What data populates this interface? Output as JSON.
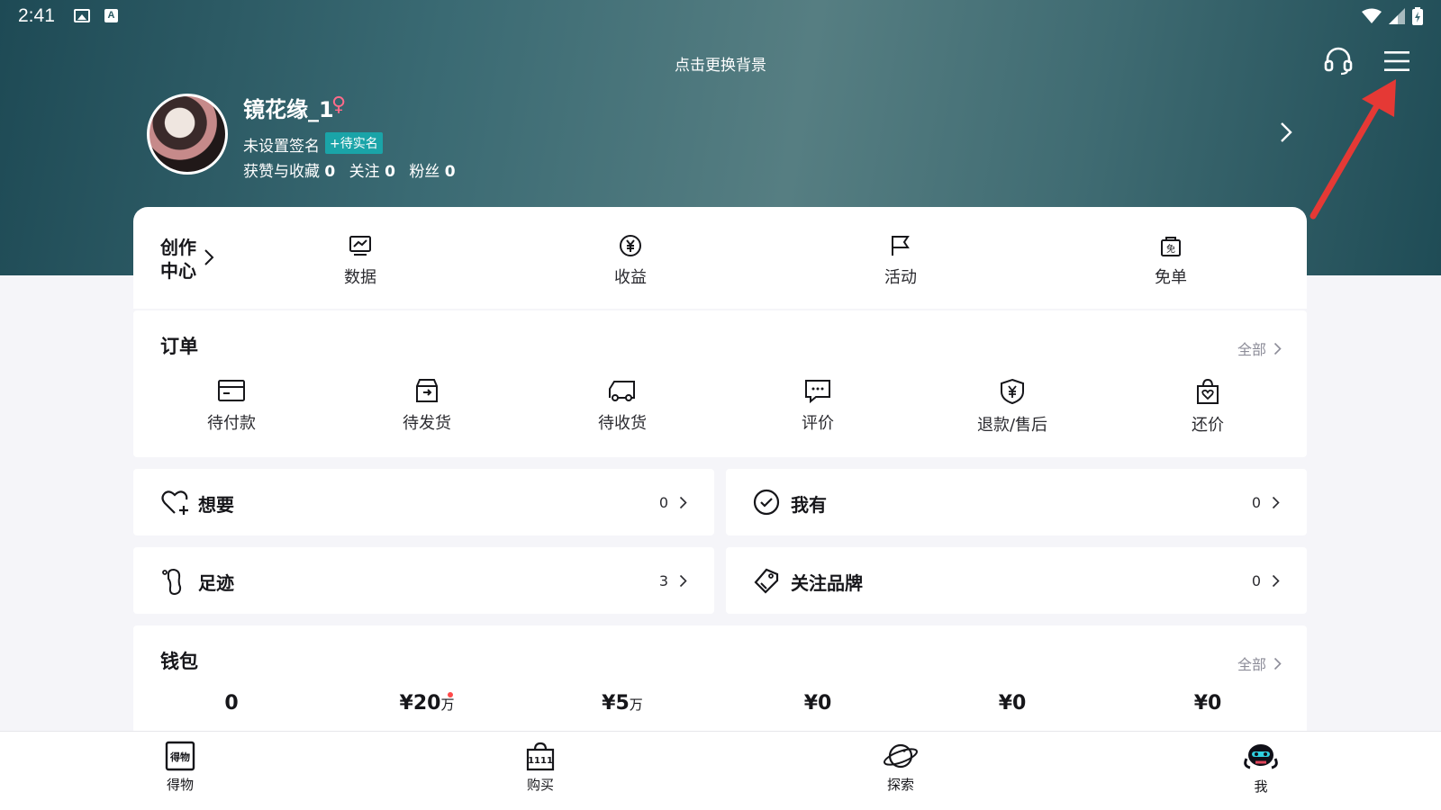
{
  "status_bar": {
    "time": "2:41"
  },
  "header": {
    "change_background": "点击更换背景"
  },
  "profile": {
    "username": "镜花缘_1",
    "gender_symbol": "♀",
    "signature": "未设置签名",
    "verify_badge": "+待实名",
    "likes_label": "获赞与收藏",
    "likes_value": "0",
    "following_label": "关注",
    "following_value": "0",
    "fans_label": "粉丝",
    "fans_value": "0"
  },
  "creation": {
    "label": "创作中心",
    "items": [
      {
        "label": "数据",
        "icon": "chart-icon"
      },
      {
        "label": "收益",
        "icon": "yen-coin-icon"
      },
      {
        "label": "活动",
        "icon": "flag-icon"
      },
      {
        "label": "免单",
        "icon": "free-bag-icon"
      }
    ]
  },
  "orders": {
    "title": "订单",
    "all_label": "全部",
    "items": [
      {
        "label": "待付款",
        "icon": "wallet-card-icon"
      },
      {
        "label": "待发货",
        "icon": "box-icon"
      },
      {
        "label": "待收货",
        "icon": "truck-icon"
      },
      {
        "label": "评价",
        "icon": "comment-icon"
      },
      {
        "label": "退款/售后",
        "icon": "shield-yen-icon"
      },
      {
        "label": "还价",
        "icon": "bag-heart-icon"
      }
    ]
  },
  "quick_rows": {
    "want": {
      "label": "想要",
      "count": "0"
    },
    "have": {
      "label": "我有",
      "count": "0"
    },
    "footprint": {
      "label": "足迹",
      "count": "3"
    },
    "brands": {
      "label": "关注品牌",
      "count": "0"
    }
  },
  "wallet": {
    "title": "钱包",
    "all_label": "全部",
    "items": [
      {
        "value": "0",
        "unit": ""
      },
      {
        "value": "¥20",
        "unit": "万"
      },
      {
        "value": "¥5",
        "unit": "万"
      },
      {
        "value": "¥0",
        "unit": ""
      },
      {
        "value": "¥0",
        "unit": ""
      },
      {
        "value": "¥0",
        "unit": ""
      }
    ]
  },
  "bottom_nav": [
    {
      "label": "得物",
      "icon": "dewu-logo-icon"
    },
    {
      "label": "购买",
      "icon": "shopping-bag-1111-icon"
    },
    {
      "label": "探索",
      "icon": "planet-icon"
    },
    {
      "label": "我",
      "icon": "avatar-mascot-icon"
    }
  ],
  "colors": {
    "header_teal": "#3a6a73",
    "badge_teal": "#1aa4a8",
    "annotation_red": "#e53935"
  }
}
